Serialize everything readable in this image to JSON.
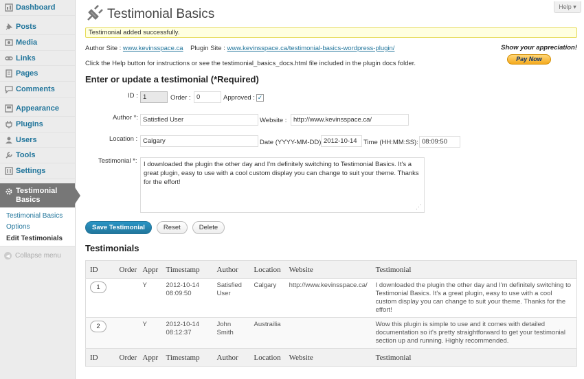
{
  "sidebar": {
    "items": [
      {
        "label": "Dashboard",
        "icon": "dashboard-icon"
      },
      {
        "label": "Posts",
        "icon": "pushpin-icon"
      },
      {
        "label": "Media",
        "icon": "media-icon"
      },
      {
        "label": "Links",
        "icon": "links-icon"
      },
      {
        "label": "Pages",
        "icon": "pages-icon"
      },
      {
        "label": "Comments",
        "icon": "comments-icon"
      },
      {
        "label": "Appearance",
        "icon": "appearance-icon"
      },
      {
        "label": "Plugins",
        "icon": "plugins-icon"
      },
      {
        "label": "Users",
        "icon": "users-icon"
      },
      {
        "label": "Tools",
        "icon": "tools-icon"
      },
      {
        "label": "Settings",
        "icon": "settings-icon"
      }
    ],
    "active": {
      "label_line1": "Testimonial",
      "label_line2": "Basics",
      "icon": "gear-icon"
    },
    "submenu": [
      "Testimonial Basics",
      "Options",
      "Edit Testimonials"
    ],
    "collapse_label": "Collapse menu"
  },
  "header": {
    "title": "Testimonial Basics",
    "help_label": "Help ▾",
    "notice": "Testimonial added successfully."
  },
  "info": {
    "author_site_label": "Author Site :",
    "author_site_link": "www.kevinsspace.ca",
    "plugin_site_label": "Plugin Site :",
    "plugin_site_link": "www.kevinsspace.ca/testimonial-basics-wordpress-plugin/",
    "help_text": "Click the Help button for instructions or see the testimonial_basics_docs.html file included in the plugin docs folder.",
    "appreciation": "Show your appreciation!",
    "paynow": "Pay Now"
  },
  "form": {
    "heading": "Enter or update a testimonial (*Required)",
    "id_label": "ID :",
    "id_value": "1",
    "order_label": "Order :",
    "order_value": "0",
    "approved_label": "Approved :",
    "approved_mark": "✓",
    "author_label": "Author *:",
    "author_value": "Satisfied User",
    "website_label": "Website :",
    "website_value": "http://www.kevinsspace.ca/",
    "location_label": "Location :",
    "location_value": "Calgary",
    "date_label": "Date (YYYY-MM-DD):",
    "date_value": "2012-10-14",
    "time_label": "Time (HH:MM:SS):",
    "time_value": "08:09:50",
    "testimonial_label": "Testimonial *:",
    "testimonial_value": "I downloaded the plugin the other day and I'm definitely switching to Testimonial Basics. It's a great plugin, easy to use with a cool custom display you can change to suit your theme. Thanks for the effort!",
    "resize_glyph": "⋰"
  },
  "buttons": {
    "save": "Save Testimonial",
    "reset": "Reset",
    "delete": "Delete"
  },
  "table": {
    "heading": "Testimonials",
    "columns": [
      "ID",
      "Order",
      "Appr",
      "Timestamp",
      "Author",
      "Location",
      "Website",
      "Testimonial"
    ],
    "rows": [
      {
        "id": "1",
        "order": "",
        "appr": "Y",
        "ts_date": "2012-10-14",
        "ts_time": "08:09:50",
        "author_l1": "Satisfied",
        "author_l2": "User",
        "location": "Calgary",
        "website": "http://www.kevinsspace.ca/",
        "testimonial": "I downloaded the plugin the other day and I'm definitely switching to Testimonial Basics. It's a great plugin, easy to use with a cool custom display you can change to suit your theme. Thanks for the effort!"
      },
      {
        "id": "2",
        "order": "",
        "appr": "Y",
        "ts_date": "2012-10-14",
        "ts_time": "08:12:37",
        "author_l1": "John",
        "author_l2": "Smith",
        "location": "Austrailia",
        "website": "",
        "testimonial": "Wow this plugin is simple to use and it comes with detailed documentation so it's pretty straightforward to get your testimonial section up and running. Highly recommended."
      }
    ]
  },
  "colors": {
    "link": "#21759b",
    "active_menu": "#777777",
    "notice_bg": "#ffffe0",
    "notice_border": "#e6db55",
    "primary_button": "#21759b"
  }
}
